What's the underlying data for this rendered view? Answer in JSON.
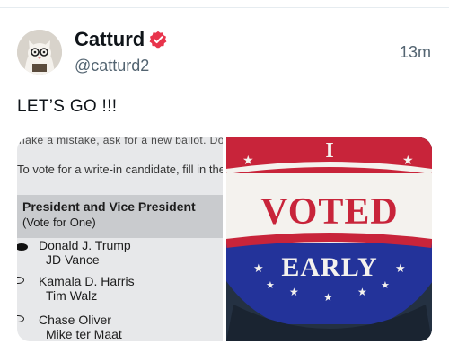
{
  "user": {
    "name": "Catturd",
    "handle": "@catturd2",
    "time": "13m"
  },
  "post": {
    "text": "LET’S GO !!!"
  },
  "ballot": {
    "top_line": "nake a mistake, ask for a new ballot. Do",
    "instruction": "To vote for a write-in candidate, fill in the",
    "office": "President and Vice President",
    "vote_for": "(Vote for One)",
    "candidates": [
      {
        "main": "Donald J. Trump",
        "sub": "JD Vance",
        "filled": true
      },
      {
        "main": "Kamala D. Harris",
        "sub": "Tim Walz",
        "filled": false
      },
      {
        "main": "Chase Oliver",
        "sub": "Mike ter Maat",
        "filled": false
      }
    ]
  },
  "sticker": {
    "top": "I",
    "voted": "VOTED",
    "early": "EARLY",
    "colors": {
      "red": "#c8243a",
      "blue": "#23339a",
      "white": "#f4f2ee"
    }
  }
}
